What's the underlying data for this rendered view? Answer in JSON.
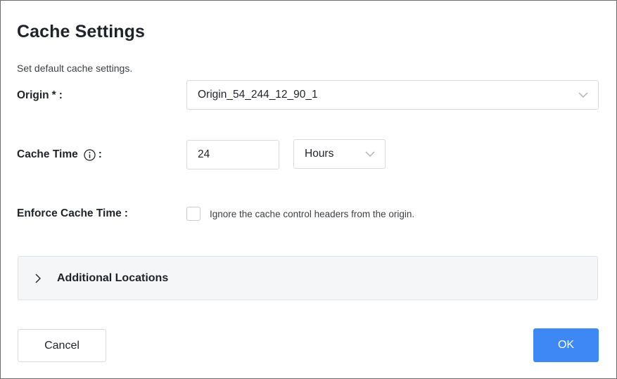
{
  "dialog": {
    "title": "Cache Settings",
    "subtitle": "Set default cache settings."
  },
  "origin": {
    "label": "Origin",
    "required_mark": "*",
    "colon": ":",
    "selected": "Origin_54_244_12_90_1"
  },
  "cache_time": {
    "label": "Cache Time",
    "colon": ":",
    "value": "24",
    "unit_selected": "Hours"
  },
  "enforce": {
    "label": "Enforce Cache Time",
    "colon": ":",
    "checked": false,
    "checkbox_label": "Ignore the cache control headers from the origin."
  },
  "additional_locations": {
    "title": "Additional Locations",
    "expanded": false
  },
  "footer": {
    "cancel_label": "Cancel",
    "ok_label": "OK"
  },
  "colors": {
    "primary": "#3d88f5",
    "border": "#d6d9de",
    "collapse_bg": "#f5f6f7",
    "text": "#1f2329"
  },
  "icons": {
    "info": "info-circle-icon",
    "dropdown": "chevron-down-icon",
    "collapse": "chevron-right-icon"
  }
}
